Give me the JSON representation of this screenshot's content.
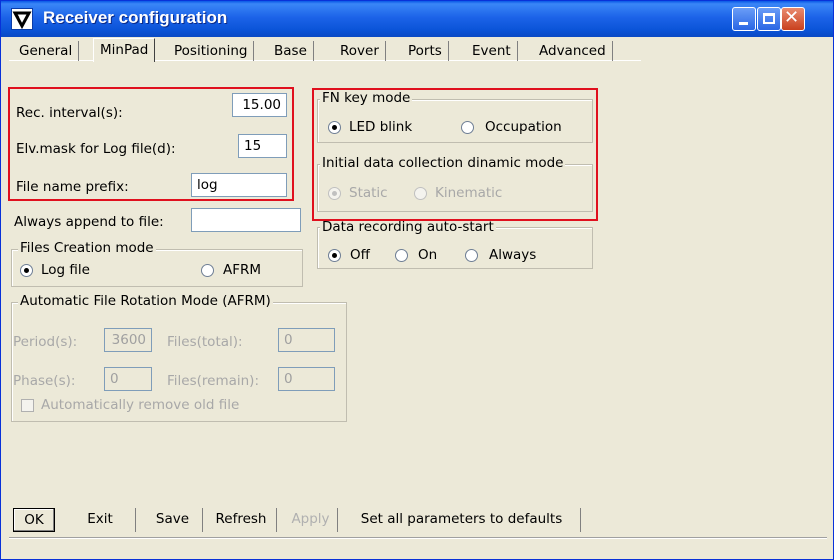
{
  "window": {
    "title": "Receiver configuration"
  },
  "tabs": [
    "General",
    "MinPad",
    "Positioning",
    "Base",
    "Rover",
    "Ports",
    "Event",
    "Advanced"
  ],
  "form": {
    "rec_interval_label": "Rec. interval(s):",
    "rec_interval_value": "15.00",
    "elv_mask_label": "Elv.mask for Log file(d):",
    "elv_mask_value": "15",
    "file_prefix_label": "File name prefix:",
    "file_prefix_value": "log",
    "always_append_label": "Always append to file:",
    "always_append_value": ""
  },
  "files_creation": {
    "title": "Files Creation mode",
    "log_file": "Log file",
    "afrm": "AFRM",
    "selected": "Log file"
  },
  "afrm_group": {
    "title": "Automatic File Rotation Mode (AFRM)",
    "period_label": "Period(s):",
    "period_value": "3600",
    "files_total_label": "Files(total):",
    "files_total_value": "0",
    "phase_label": "Phase(s):",
    "phase_value": "0",
    "files_remain_label": "Files(remain):",
    "files_remain_value": "0",
    "auto_remove_label": "Automatically remove old file"
  },
  "fn_key": {
    "title": "FN key mode",
    "led_blink": "LED blink",
    "occupation": "Occupation",
    "selected": "LED blink"
  },
  "initial_mode": {
    "title": "Initial data collection dinamic mode",
    "static": "Static",
    "kinematic": "Kinematic",
    "selected": "Static"
  },
  "auto_start": {
    "title": "Data recording auto-start",
    "off": "Off",
    "on": "On",
    "always": "Always",
    "selected": "Off"
  },
  "buttons": {
    "ok": "OK",
    "exit": "Exit",
    "save": "Save",
    "refresh": "Refresh",
    "apply": "Apply",
    "defaults": "Set all parameters to defaults"
  },
  "colors": {
    "titlebar": "#0a58e6",
    "highlight_box": "#e0101e",
    "background": "#ece9d8"
  }
}
